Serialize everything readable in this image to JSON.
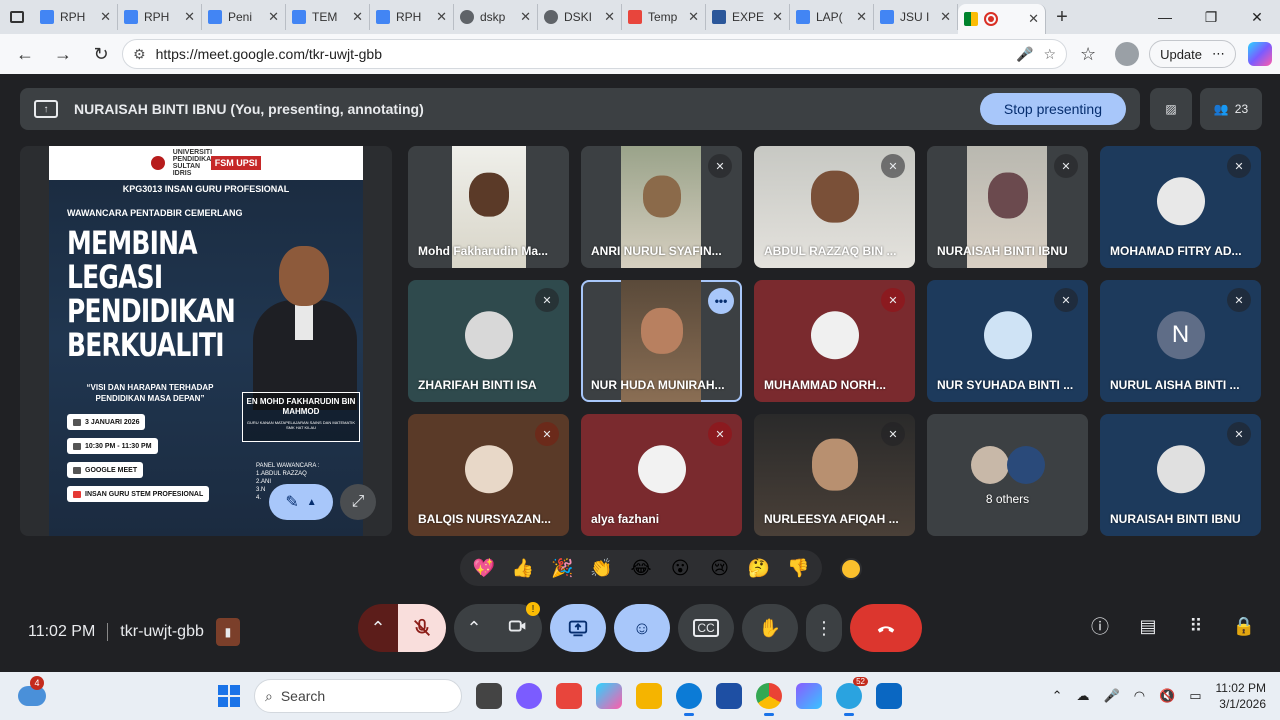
{
  "browser": {
    "tabs": [
      {
        "label": "RPH",
        "color": "#4285f4"
      },
      {
        "label": "RPH",
        "color": "#4285f4"
      },
      {
        "label": "Peni",
        "color": "#4285f4"
      },
      {
        "label": "TEM",
        "color": "#4285f4"
      },
      {
        "label": "RPH",
        "color": "#4285f4"
      },
      {
        "label": "dskp",
        "color": "#5f6368"
      },
      {
        "label": "DSKI",
        "color": "#5f6368"
      },
      {
        "label": "Temp",
        "color": "#e8453c"
      },
      {
        "label": "EXPE",
        "color": "#2b579a"
      },
      {
        "label": "LAP(",
        "color": "#4285f4"
      },
      {
        "label": "JSU I",
        "color": "#4285f4"
      }
    ],
    "url": "https://meet.google.com/tkr-uwjt-gbb",
    "update_label": "Update"
  },
  "meet": {
    "presenter_banner": "NURAISAH BINTI IBNU (You, presenting, annotating)",
    "stop_presenting": "Stop presenting",
    "participant_count": "23",
    "time": "11:02 PM",
    "meeting_code": "tkr-uwjt-gbb",
    "slide": {
      "course": "KPG3013  INSAN GURU PROFESIONAL",
      "subtitle": "WAWANCARA PENTADBIR CEMERLANG",
      "headline_1": "MEMBINA",
      "headline_2": "LEGASI",
      "headline_3": "PENDIDIKAN",
      "headline_4": "BERKUALITI",
      "vision": "“VISI DAN HARAPAN TERHADAP PENDIDIKAN MASA DEPAN”",
      "date": "3 JANUARI 2026",
      "time": "10:30 PM - 11:30 PM",
      "platform": "GOOGLE MEET",
      "channel": "INSAN GURU STEM PROFESIONAL",
      "guest_name": "EN MOHD FAKHARUDIN BIN MAHMOD",
      "guest_role": "GURU KANAN MATAPELAJARAN SAINS DAN MATEMATIK SMK HAT KILAU",
      "panel_title": "PANEL WAWANCARA :",
      "panel_1": "1.ABDUL RAZZAQ",
      "panel_2": "2.ANI",
      "panel_3": "3.N",
      "panel_4": "4.",
      "logo_text": "FSM UPSI",
      "uni_text": "UNIVERSITI PENDIDIKAN SULTAN IDRIS"
    },
    "participants": [
      {
        "name": "Mohd Fakharudin Ma...",
        "muted": false
      },
      {
        "name": "ANRI NURUL SYAFIN...",
        "muted": true
      },
      {
        "name": "ABDUL RAZZAQ BIN ...",
        "muted": true
      },
      {
        "name": "NURAISAH BINTI IBNU",
        "muted": true
      },
      {
        "name": "MOHAMAD FITRY AD...",
        "muted": true
      },
      {
        "name": "ZHARIFAH BINTI ISA",
        "muted": true
      },
      {
        "name": "NUR HUDA MUNIRAH...",
        "muted": false
      },
      {
        "name": "MUHAMMAD NORH...",
        "muted": true
      },
      {
        "name": "NUR SYUHADA BINTI ...",
        "muted": true
      },
      {
        "name": "NURUL AISHA BINTI ...",
        "muted": true,
        "initial": "N"
      },
      {
        "name": "BALQIS NURSYAZAN...",
        "muted": true
      },
      {
        "name": "alya fazhani",
        "muted": true
      },
      {
        "name": "NURLEESYA AFIQAH ...",
        "muted": true
      },
      {
        "name": "8 others",
        "muted": false
      },
      {
        "name": "NURAISAH BINTI IBNU",
        "muted": true
      }
    ],
    "reactions": [
      "💖",
      "👍",
      "🎉",
      "👏",
      "😂",
      "😮",
      "😢",
      "🤔",
      "👎"
    ]
  },
  "taskbar": {
    "weather_badge": "4",
    "search_placeholder": "Search",
    "telegram_badge": "52",
    "clock_time": "11:02 PM",
    "clock_date": "3/1/2026"
  }
}
